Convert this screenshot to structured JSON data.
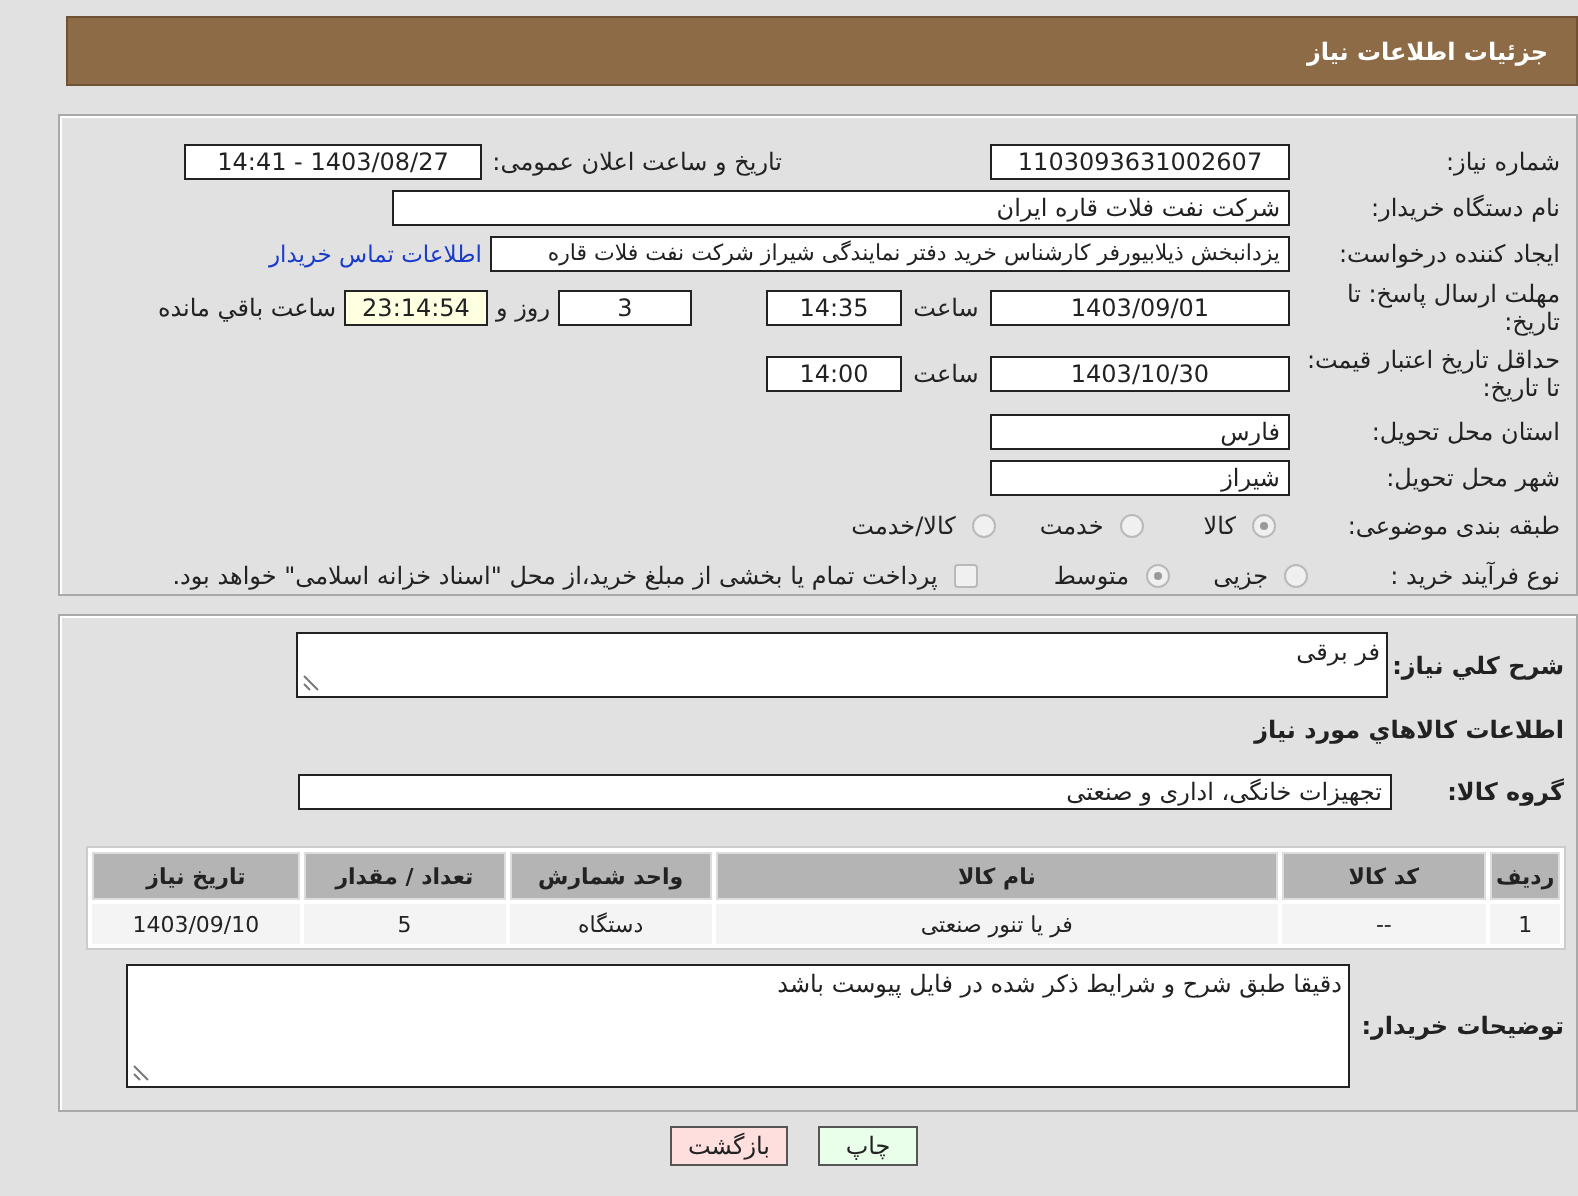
{
  "header": {
    "title": "جزئیات اطلاعات نیاز"
  },
  "need_number": {
    "label": "شماره نیاز:",
    "value": "1103093631002607"
  },
  "announce_datetime": {
    "label": "تاریخ و ساعت اعلان عمومی:",
    "value": "1403/08/27 - 14:41"
  },
  "buyer_org": {
    "label": "نام دستگاه خریدار:",
    "value": "شرکت نفت فلات قاره ایران"
  },
  "requester": {
    "label": "ایجاد کننده درخواست:",
    "value": "یزدانبخش ذیلابیورفر کارشناس خرید دفتر نمایندگی شیراز شرکت نفت فلات قاره",
    "link": "اطلاعات تماس خریدار"
  },
  "response_deadline": {
    "label": "مهلت ارسال پاسخ: تا تاریخ:",
    "date": "1403/09/01",
    "time_label": "ساعت",
    "time": "14:35",
    "days": "3",
    "days_label": "روز و",
    "remaining": "23:14:54",
    "remaining_label": "ساعت باقي مانده"
  },
  "price_validity": {
    "label": "حداقل تاریخ اعتبار قیمت: تا تاریخ:",
    "date": "1403/10/30",
    "time_label": "ساعت",
    "time": "14:00"
  },
  "province": {
    "label": "استان محل تحویل:",
    "value": "فارس"
  },
  "city": {
    "label": "شهر محل تحویل:",
    "value": "شیراز"
  },
  "category": {
    "label": "طبقه بندی موضوعی:",
    "options": [
      {
        "label": "کالا",
        "selected": true
      },
      {
        "label": "خدمت",
        "selected": false
      },
      {
        "label": "کالا/خدمت",
        "selected": false
      }
    ]
  },
  "purchase_process": {
    "label": "نوع فرآیند خرید :",
    "options": [
      {
        "label": "جزیی",
        "selected": false
      },
      {
        "label": "متوسط",
        "selected": true
      }
    ],
    "payment_note": {
      "checked": false,
      "text": "پرداخت تمام یا بخشی از مبلغ خرید،از محل \"اسناد خزانه اسلامی\" خواهد بود."
    }
  },
  "description": {
    "label": "شرح کلي نیاز:",
    "value": "فر برقی"
  },
  "goods_title": "اطلاعات کالاهاي مورد نیاز",
  "goods_group": {
    "label": "گروه کالا:",
    "value": "تجهیزات خانگی، اداری و صنعتی"
  },
  "table": {
    "columns": [
      "ردیف",
      "کد کالا",
      "نام کالا",
      "واحد شمارش",
      "تعداد / مقدار",
      "تاریخ نیاز"
    ],
    "rows": [
      [
        "1",
        "--",
        "فر یا تنور صنعتی",
        "دستگاه",
        "5",
        "1403/09/10"
      ]
    ]
  },
  "buyer_notes": {
    "label": "توضیحات خریدار:",
    "value": "دقیقا طبق شرح و شرایط ذکر شده در فایل پیوست باشد"
  },
  "buttons": [
    {
      "label": "چاپ",
      "kind": "print"
    },
    {
      "label": "بازگشت",
      "kind": "back"
    }
  ]
}
